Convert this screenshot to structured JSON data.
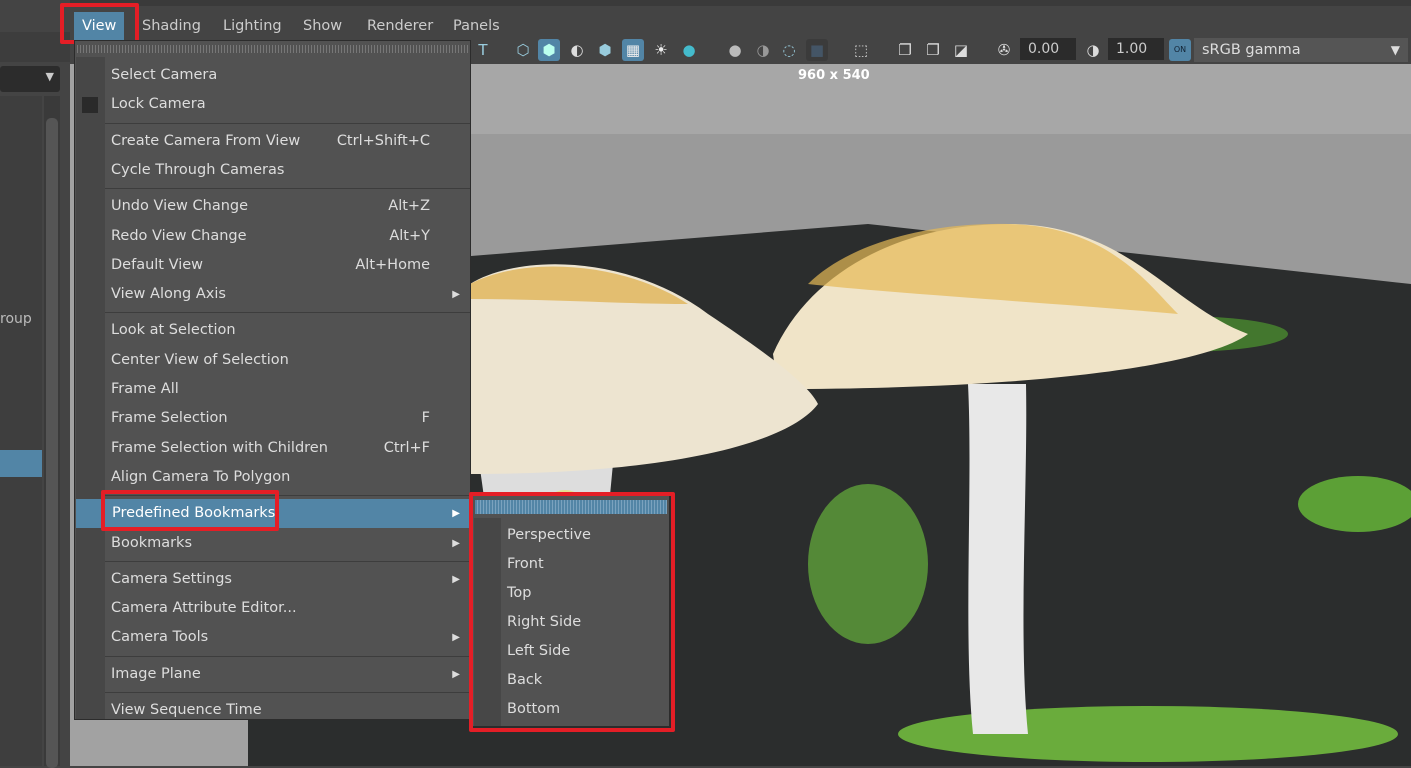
{
  "menubar": {
    "items": [
      "View",
      "Shading",
      "Lighting",
      "Show",
      "Renderer",
      "Panels"
    ]
  },
  "toolbar": {
    "exposure": "0.00",
    "gamma": "1.00",
    "on_badge": "ON",
    "color_space": "sRGB gamma"
  },
  "viewport": {
    "resolution": "960 x 540"
  },
  "left_panel": {
    "partial_label": "roup"
  },
  "view_menu": {
    "groups": [
      [
        {
          "label": "Select Camera"
        },
        {
          "label": "Lock Camera",
          "check": true
        }
      ],
      [
        {
          "label": "Create Camera From View",
          "shortcut": "Ctrl+Shift+C"
        },
        {
          "label": "Cycle Through Cameras"
        }
      ],
      [
        {
          "label": "Undo View Change",
          "shortcut": "Alt+Z"
        },
        {
          "label": "Redo View Change",
          "shortcut": "Alt+Y"
        },
        {
          "label": "Default View",
          "shortcut": "Alt+Home"
        },
        {
          "label": "View Along Axis",
          "submenu": true
        }
      ],
      [
        {
          "label": "Look at Selection"
        },
        {
          "label": "Center View of Selection"
        },
        {
          "label": "Frame All"
        },
        {
          "label": "Frame Selection",
          "shortcut": "F"
        },
        {
          "label": "Frame Selection with Children",
          "shortcut": "Ctrl+F"
        },
        {
          "label": "Align Camera To Polygon"
        }
      ],
      [
        {
          "label": "Predefined Bookmarks",
          "submenu": true,
          "highlighted": true
        },
        {
          "label": "Bookmarks",
          "submenu": true
        }
      ],
      [
        {
          "label": "Camera Settings",
          "submenu": true
        },
        {
          "label": "Camera Attribute Editor..."
        },
        {
          "label": "Camera Tools",
          "submenu": true
        }
      ],
      [
        {
          "label": "Image Plane",
          "submenu": true
        }
      ],
      [
        {
          "label": "View Sequence Time"
        }
      ]
    ]
  },
  "bookmarks_submenu": {
    "items": [
      "Perspective",
      "Front",
      "Top",
      "Right Side",
      "Left Side",
      "Back",
      "Bottom"
    ]
  },
  "colors": {
    "highlight": "#5285a6",
    "annotation": "#e41e26",
    "menu_bg": "#525252"
  }
}
